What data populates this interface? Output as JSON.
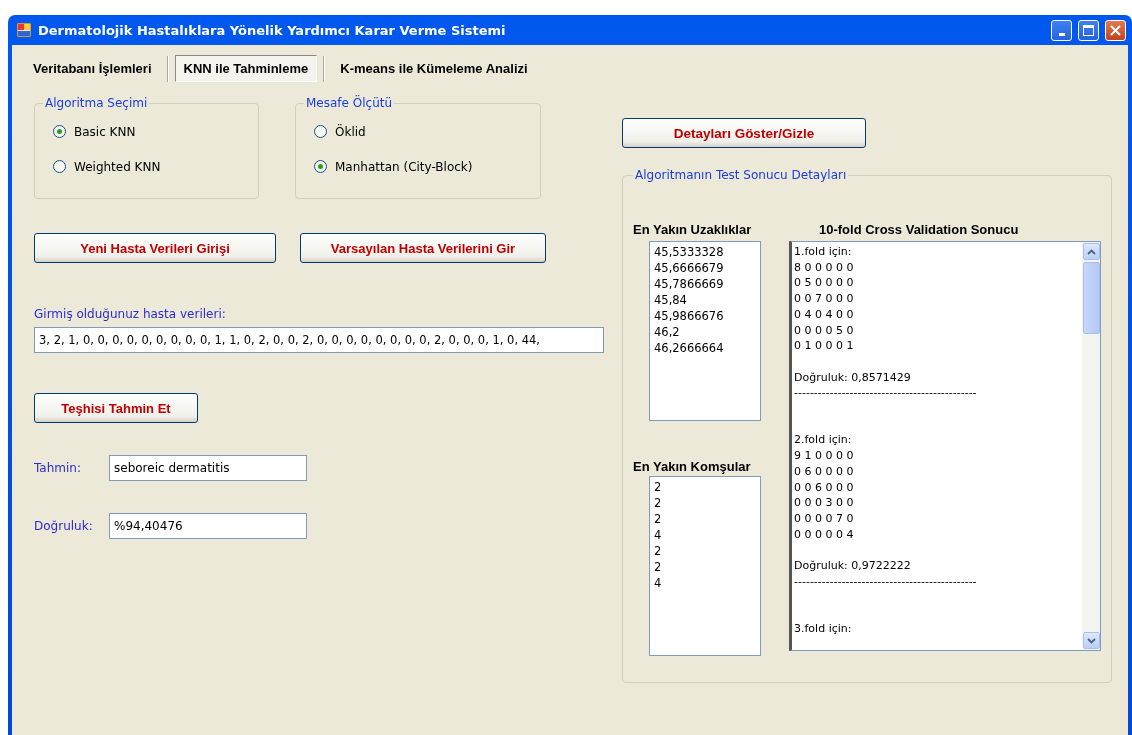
{
  "window": {
    "title": "Dermatolojik Hastalıklara Yönelik Yardımcı Karar Verme Sistemi"
  },
  "tabs": [
    {
      "label": "Veritabanı İşlemleri",
      "selected": false
    },
    {
      "label": "KNN ile Tahminleme",
      "selected": true
    },
    {
      "label": "K-means ile Kümeleme Analizi",
      "selected": false
    }
  ],
  "algorithm_group": {
    "title": "Algoritma Seçimi",
    "options": [
      {
        "label": "Basic KNN",
        "selected": true
      },
      {
        "label": "Weighted KNN",
        "selected": false
      }
    ]
  },
  "distance_group": {
    "title": "Mesafe Ölçütü",
    "options": [
      {
        "label": "Öklid",
        "selected": false
      },
      {
        "label": "Manhattan (City-Block)",
        "selected": true
      }
    ]
  },
  "entry_buttons": [
    "Yeni Hasta Verileri Girişi",
    "Varsayılan Hasta Verilerini Gir"
  ],
  "entered_data": {
    "label": "Girmiş olduğunuz hasta verileri:",
    "value": "3, 2, 1, 0, 0, 0, 0, 0, 0, 0, 0, 0, 1, 1, 0, 2, 0, 0, 2, 0, 0, 0, 0, 0, 0, 0, 0, 2, 0, 0, 0, 1, 0, 44,"
  },
  "predict_button": "Teşhisi Tahmin Et",
  "results": [
    {
      "label": "Tahmin:",
      "value": "seboreic dermatitis"
    },
    {
      "label": "Doğruluk:",
      "value": "%94,40476"
    }
  ],
  "details_button": "Detayları Göster/Gizle",
  "details_group": {
    "title": "Algoritmanın Test Sonucu Detayları",
    "distances": {
      "title": "En Yakın Uzaklıklar",
      "items": [
        "45,5333328",
        "45,6666679",
        "45,7866669",
        "45,84",
        "45,9866676",
        "46,2",
        "46,2666664"
      ]
    },
    "neighbors": {
      "title": "En Yakın Komşular",
      "items": [
        "2",
        "2",
        "2",
        "4",
        "2",
        "2",
        "4"
      ]
    },
    "cross_validation": {
      "title": "10-fold Cross Validation Sonucu",
      "folds": [
        {
          "title": "1.fold için:",
          "matrix": [
            "8 0 0 0 0 0",
            "0 5 0 0 0 0",
            "0 0 7 0 0 0",
            "0 4 0 4 0 0",
            "0 0 0 0 5 0",
            "0 1 0 0 0 1"
          ],
          "accuracy": "Doğruluk: 0,8571429",
          "separator": "----------------------------------------------"
        },
        {
          "title": "2.fold için:",
          "matrix": [
            "9 1 0 0 0 0",
            "0 6 0 0 0 0",
            "0 0 6 0 0 0",
            "0 0 0 3 0 0",
            "0 0 0 0 7 0",
            "0 0 0 0 0 4"
          ],
          "accuracy": "Doğruluk: 0,9722222",
          "separator": "----------------------------------------------"
        },
        {
          "title": "3.fold için:"
        }
      ]
    }
  }
}
